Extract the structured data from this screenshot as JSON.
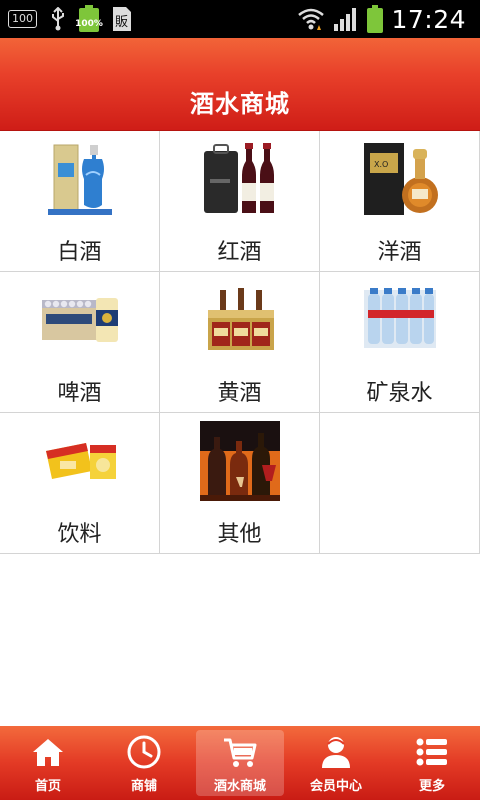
{
  "status_bar": {
    "left_badge": "100",
    "battery_small_pct": "100%",
    "time": "17:24"
  },
  "header": {
    "title": "酒水商城"
  },
  "categories": [
    {
      "label": "白酒",
      "icon": "baijiu-product-image"
    },
    {
      "label": "红酒",
      "icon": "red-wine-product-image"
    },
    {
      "label": "洋酒",
      "icon": "liquor-product-image"
    },
    {
      "label": "啤酒",
      "icon": "beer-product-image"
    },
    {
      "label": "黄酒",
      "icon": "yellow-wine-product-image"
    },
    {
      "label": "矿泉水",
      "icon": "mineral-water-product-image"
    },
    {
      "label": "饮料",
      "icon": "beverage-product-image"
    },
    {
      "label": "其他",
      "icon": "other-drinks-product-image"
    }
  ],
  "tabs": [
    {
      "label": "首页",
      "icon": "home-icon"
    },
    {
      "label": "商铺",
      "icon": "clock-icon"
    },
    {
      "label": "酒水商城",
      "icon": "cart-icon",
      "active": true
    },
    {
      "label": "会员中心",
      "icon": "user-icon"
    },
    {
      "label": "更多",
      "icon": "list-icon"
    }
  ],
  "colors": {
    "header": "#e33a25",
    "tabbar": "#e33a25",
    "battery": "#7ec63a"
  }
}
